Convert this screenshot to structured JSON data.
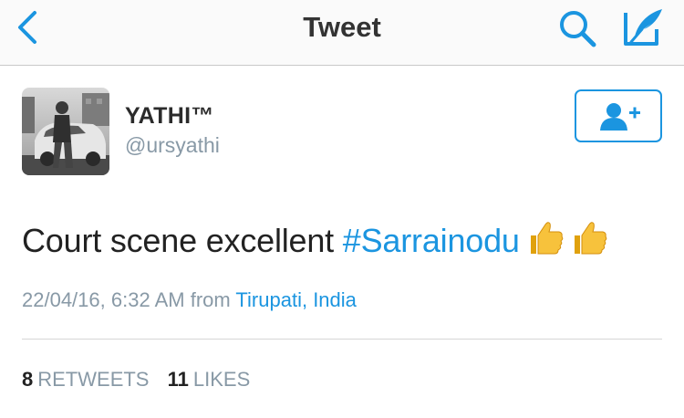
{
  "nav": {
    "title": "Tweet",
    "back_icon": "chevron-left-icon",
    "search_icon": "search-icon",
    "compose_icon": "compose-tweet-icon",
    "accent_color": "#1b95e0"
  },
  "author": {
    "display_name": "YATHI™",
    "handle": "@ursyathi",
    "follow_icon": "add-user-icon"
  },
  "tweet": {
    "text": "Court scene excellent ",
    "hashtag": "#Sarrainodu",
    "emoji": "thumbs-up-icon",
    "timestamp": "22/04/16, 6:32 AM",
    "from_label": "from",
    "location": "Tirupati, India"
  },
  "stats": {
    "retweets_count": "8",
    "retweets_label": "RETWEETS",
    "likes_count": "11",
    "likes_label": "LIKES"
  }
}
